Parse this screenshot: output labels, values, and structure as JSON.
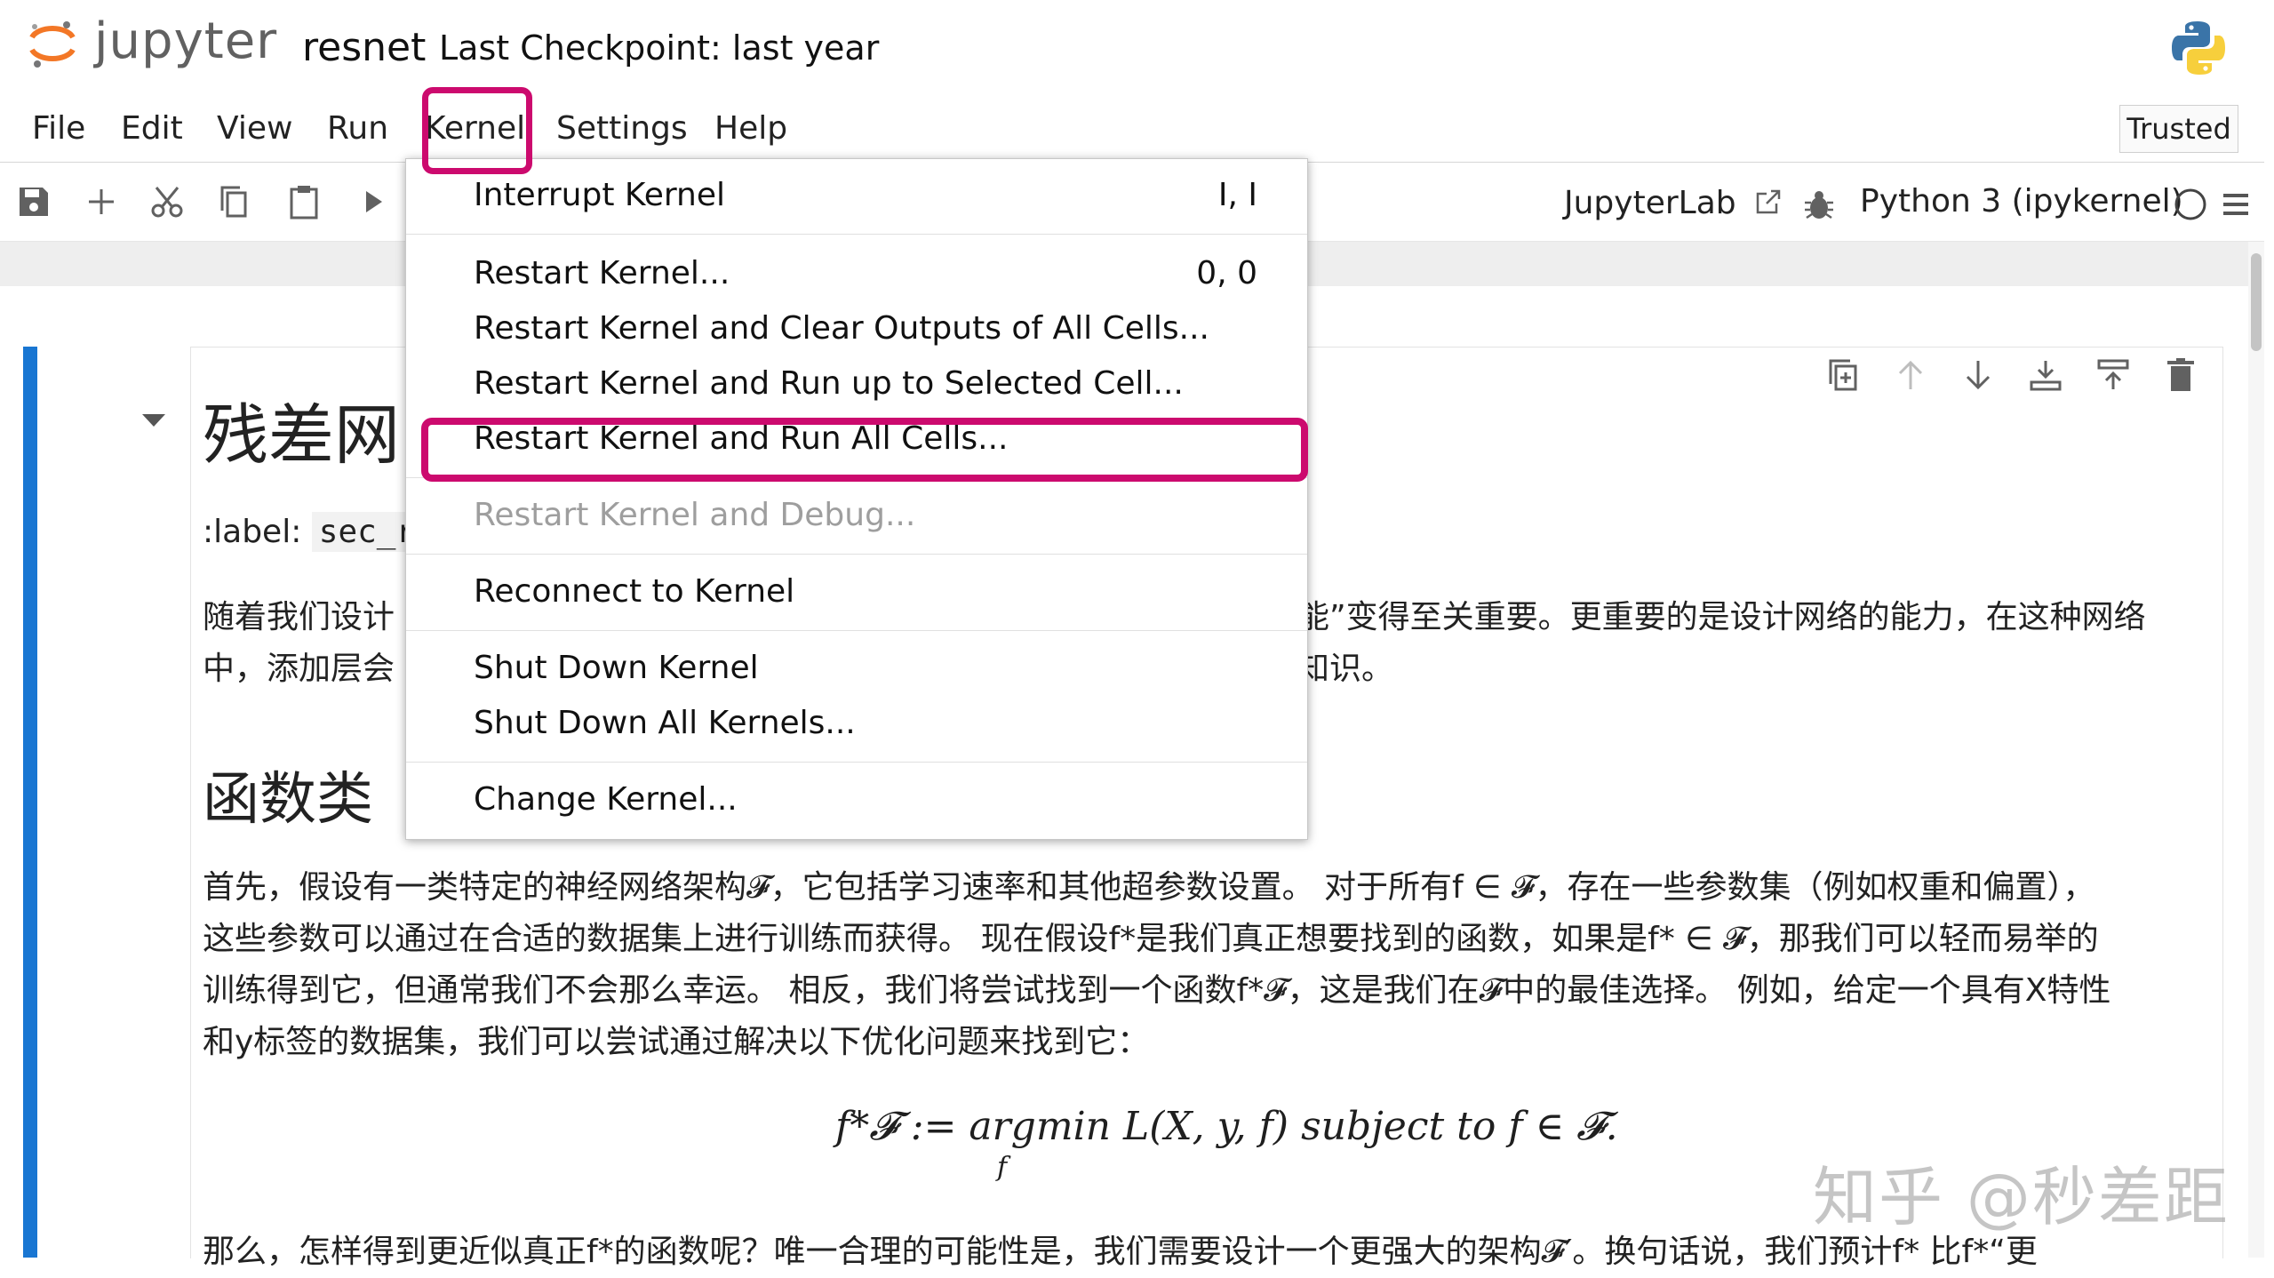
{
  "header": {
    "logo_text": "jupyter",
    "notebook_name": "resnet",
    "checkpoint": "Last Checkpoint: last year"
  },
  "menubar": {
    "items": [
      "File",
      "Edit",
      "View",
      "Run",
      "Kernel",
      "Settings",
      "Help"
    ],
    "trusted": "Trusted"
  },
  "toolbar": {
    "icons": [
      "save-icon",
      "add-icon",
      "cut-icon",
      "copy-icon",
      "paste-icon",
      "run-icon"
    ],
    "jupyterlab_label": "JupyterLab",
    "kernel_label": "Python 3 (ipykernel)"
  },
  "kernel_menu": {
    "items": [
      {
        "label": "Interrupt Kernel",
        "shortcut": "I, I"
      },
      {
        "label": "Restart Kernel...",
        "shortcut": "0, 0"
      },
      {
        "label": "Restart Kernel and Clear Outputs of All Cells...",
        "shortcut": ""
      },
      {
        "label": "Restart Kernel and Run up to Selected Cell...",
        "shortcut": ""
      },
      {
        "label": "Restart Kernel and Run All Cells...",
        "shortcut": ""
      },
      {
        "label": "Restart Kernel and Debug...",
        "shortcut": "",
        "disabled": true
      },
      {
        "label": "Reconnect to Kernel",
        "shortcut": ""
      },
      {
        "label": "Shut Down Kernel",
        "shortcut": ""
      },
      {
        "label": "Shut Down All Kernels...",
        "shortcut": ""
      },
      {
        "label": "Change Kernel...",
        "shortcut": ""
      }
    ]
  },
  "notebook": {
    "title_visible": "残差网",
    "label_prefix": ":label:",
    "label_code": "sec_re",
    "intro_line1_left": "随着我们设计",
    "intro_line1_right": "能”变得至关重要。更重要的是设计网络的能力，在这种网络",
    "intro_line2_left": "中，添加层会",
    "intro_line2_right": "知识。",
    "section_title": "函数类",
    "para_lines": [
      "首先，假设有一类特定的神经网络架构𝓕，它包括学习速率和其他超参数设置。 对于所有f ∈ 𝓕，存在一些参数集（例如权重和偏置），",
      "这些参数可以通过在合适的数据集上进行训练而获得。 现在假设f*是我们真正想要找到的函数，如果是f* ∈ 𝓕，那我们可以轻而易举的",
      "训练得到它，但通常我们不会那么幸运。 相反，我们将尝试找到一个函数f*𝓕，这是我们在𝓕中的最佳选择。 例如，给定一个具有X特性",
      "和y标签的数据集，我们可以尝试通过解决以下优化问题来找到它："
    ],
    "equation": "f*𝓕 := argmin L(X, y, f) subject to f ∈ 𝓕.",
    "equation_sub": "f",
    "cut_line": "那么，怎样得到更近似真正f*的函数呢？唯一合理的可能性是，我们需要设计一个更强大的架构𝓕′。换句话说，我们预计f* 比f*“更"
  },
  "watermark": "知乎 @秒差距",
  "colors": {
    "highlight": "#cc0a6e",
    "active_cell": "#1976d2",
    "jupyter_orange": "#f37726"
  }
}
